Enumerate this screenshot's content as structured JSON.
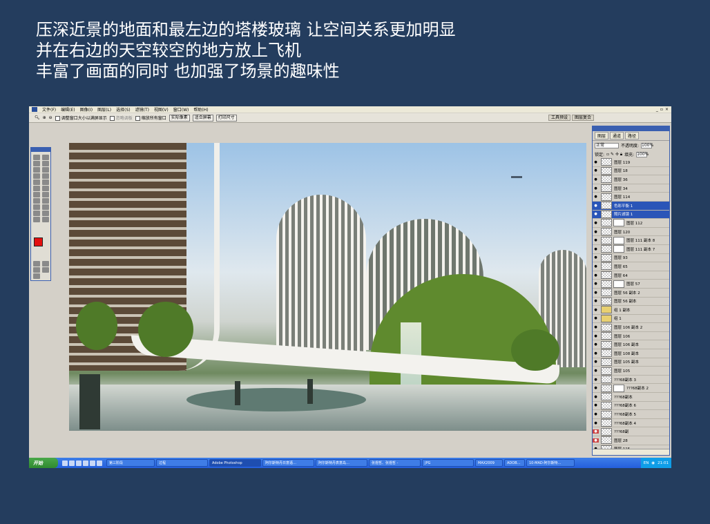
{
  "caption": {
    "line1": "压深近景的地面和最左边的塔楼玻璃 让空间关系更加明显",
    "line2": "并在右边的天空较空的地方放上飞机",
    "line3": "丰富了画面的同时 也加强了场景的趣味性"
  },
  "menu": [
    "文件(F)",
    "编辑(E)",
    "图像(I)",
    "图层(L)",
    "选择(S)",
    "滤镜(T)",
    "视图(V)",
    "窗口(W)",
    "帮助(H)"
  ],
  "options": {
    "resize_windows": "调整窗口大小以满屏显示",
    "ignore_palettes": "忽略调板",
    "zoom_all": "缩放所有窗口",
    "actual_pixels": "实际像素",
    "fit_screen": "适合屏幕",
    "print_size": "打印尺寸",
    "well_tabs": [
      "工具预设",
      "图层复合"
    ]
  },
  "layers_panel": {
    "tabs": [
      "图层",
      "通道",
      "路径"
    ],
    "blend_mode": "正常",
    "opacity_label": "不透明度:",
    "opacity_value": "100%",
    "lock_label": "锁定:",
    "fill_label": "填充:",
    "fill_value": "100%",
    "layers": [
      "图层 119",
      "图层 18",
      "图层 36",
      "图层 34",
      "图层 114",
      "色彩平衡 1",
      "照片滤镜 1",
      "图层 112",
      "图层 120",
      "图层 111 副本 8",
      "图层 111 副本 7",
      "图层 93",
      "图层 65",
      "图层 64",
      "图层 57",
      "图层 56 副本 2",
      "图层 56 副本",
      "组 1 副本",
      "组 1",
      "图层 106 副本 2",
      "图层 106",
      "图层 106 副本",
      "图层 108 副本",
      "图层 105 副本",
      "图层 105",
      "???68副本 3",
      "???68副本 2",
      "???68副本",
      "???68副本 6",
      "???68副本 5",
      "???68副本 4",
      "???68副",
      "图层 28",
      "图层 115"
    ]
  },
  "taskbar": {
    "start": "开始",
    "tasks": [
      "第三阶段",
      "过程",
      "Adobe Photoshop",
      "阿尔斯特丹日意语…",
      "阿尔斯特丹表意岛…",
      "张煜哲、张煜哲 -",
      "JPG",
      "MAX2009",
      "ADOB…",
      "10-MAD-阿尔斯特…"
    ],
    "tray_lang": "EN",
    "clock": "21:01"
  }
}
